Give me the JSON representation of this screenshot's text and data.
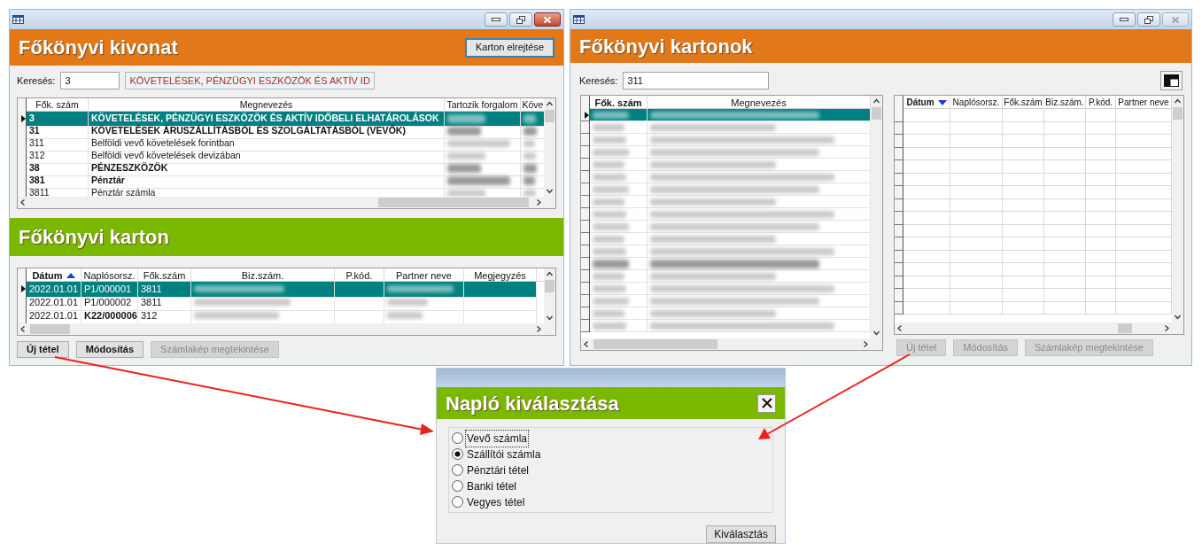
{
  "summary_window": {
    "close_enabled": true,
    "title": "Főkönyvi kivonat",
    "hide_button": "Karton elrejtése",
    "search": {
      "label": "Keresés:",
      "value": "3",
      "description": "KÖVETELÉSEK, PÉNZÜGYI ESZKÖZÖK ÉS AKTÍV ID"
    },
    "accounts": {
      "columns": [
        {
          "label": "Fők. szám",
          "kind": "text",
          "bold": false
        },
        {
          "label": "Megnevezés",
          "kind": "text",
          "bold": false
        },
        {
          "label": "Tartozik forgalom",
          "kind": "blurred",
          "bold": false
        },
        {
          "label": "Köve",
          "kind": "blurred",
          "bold": false
        }
      ],
      "rows": [
        {
          "cells": [
            "3",
            "KÖVETELÉSEK, PÉNZÜGYI ESZKÖZÖK ÉS AKTÍV IDŐBELI ELHATÁROLÁSOK"
          ],
          "bold": true,
          "selected": true
        },
        {
          "cells": [
            "31",
            "KÖVETELÉSEK ÁRUSZÁLLÍTÁSBÓL ÉS SZOLGÁLTATÁSBÓL (VEVŐK)"
          ],
          "bold": true,
          "selected": false
        },
        {
          "cells": [
            "311",
            "Belföldi vevő követelések forintban"
          ],
          "bold": false,
          "selected": false
        },
        {
          "cells": [
            "312",
            "Belföldi vevő követelések devizában"
          ],
          "bold": false,
          "selected": false
        },
        {
          "cells": [
            "38",
            "PÉNZESZKÖZÖK"
          ],
          "bold": true,
          "selected": false
        },
        {
          "cells": [
            "381",
            "Pénztár"
          ],
          "bold": true,
          "selected": false
        },
        {
          "cells": [
            "3811",
            "Pénztár számla"
          ],
          "bold": false,
          "selected": false
        }
      ]
    },
    "card": {
      "title": "Főkönyvi karton",
      "columns": [
        {
          "label": "Dátum",
          "kind": "text",
          "bold": true,
          "sort_descending": false
        },
        {
          "label": "Naplósorsz.",
          "kind": "text",
          "bold": false
        },
        {
          "label": "Fők.szám",
          "kind": "text",
          "bold": false
        },
        {
          "label": "Biz.szám.",
          "kind": "blurred",
          "bold": false
        },
        {
          "label": "P.kód.",
          "kind": "empty",
          "bold": false
        },
        {
          "label": "Partner neve",
          "kind": "blurred",
          "bold": false
        },
        {
          "label": "Megjegyzés",
          "kind": "empty",
          "bold": false
        }
      ],
      "rows": [
        {
          "cells": [
            "2022.01.01",
            "P1/000001",
            "3811"
          ],
          "bold": false,
          "selected": true
        },
        {
          "cells": [
            "2022.01.01",
            "P1/000002",
            "3811"
          ],
          "bold": false,
          "selected": false
        },
        {
          "cells": [
            "2022.01.01",
            "**K22/000006**",
            "312"
          ],
          "bold": false,
          "selected": false
        }
      ],
      "buttons": [
        {
          "label": "Új tétel",
          "disabled": false
        },
        {
          "label": "Módosítás",
          "disabled": false
        },
        {
          "label": "Számlakép megtekintése",
          "disabled": true
        }
      ]
    }
  },
  "cards_window": {
    "close_enabled": false,
    "title": "Főkönyvi kartonok",
    "search": {
      "label": "Keresés:",
      "value": "311"
    },
    "accounts": {
      "columns": [
        {
          "label": "Fők. szám",
          "kind": "blurred",
          "bold": true
        },
        {
          "label": "Megnevezés",
          "kind": "blurred",
          "bold": false
        }
      ],
      "rows": [
        {
          "selected": true,
          "bold": false
        },
        {
          "selected": false,
          "bold": false
        },
        {
          "selected": false,
          "bold": false
        },
        {
          "selected": false,
          "bold": false
        },
        {
          "selected": false,
          "bold": false
        },
        {
          "selected": false,
          "bold": false
        },
        {
          "selected": false,
          "bold": false
        },
        {
          "selected": false,
          "bold": false
        },
        {
          "selected": false,
          "bold": false
        },
        {
          "selected": false,
          "bold": false
        },
        {
          "selected": false,
          "bold": false
        },
        {
          "selected": false,
          "bold": false
        },
        {
          "selected": false,
          "bold": true
        },
        {
          "selected": false,
          "bold": false
        },
        {
          "selected": false,
          "bold": false
        },
        {
          "selected": false,
          "bold": false
        },
        {
          "selected": false,
          "bold": false
        },
        {
          "selected": false,
          "bold": false
        }
      ]
    },
    "entries": {
      "columns": [
        {
          "label": "Dátum",
          "bold": true,
          "sort_descending": true
        },
        {
          "label": "Naplósorsz.",
          "bold": false
        },
        {
          "label": "Fők.szám",
          "bold": false
        },
        {
          "label": "Biz.szám.",
          "bold": false
        },
        {
          "label": "P.kód.",
          "bold": false
        },
        {
          "label": "Partner neve",
          "bold": false
        }
      ]
    },
    "buttons": [
      {
        "label": "Új tétel",
        "disabled": true
      },
      {
        "label": "Módosítás",
        "disabled": true
      },
      {
        "label": "Számlakép megtekintése",
        "disabled": true
      }
    ]
  },
  "dialog": {
    "title": "Napló kiválasztása",
    "options": [
      {
        "label": "Vevő számla",
        "selected": false,
        "focused": true
      },
      {
        "label": "Szállítói számla",
        "selected": true,
        "focused": false
      },
      {
        "label": "Pénztári tétel",
        "selected": false,
        "focused": false
      },
      {
        "label": "Banki tétel",
        "selected": false,
        "focused": false
      },
      {
        "label": "Vegyes tétel",
        "selected": false,
        "focused": false
      }
    ],
    "button": "Kiválasztás"
  }
}
